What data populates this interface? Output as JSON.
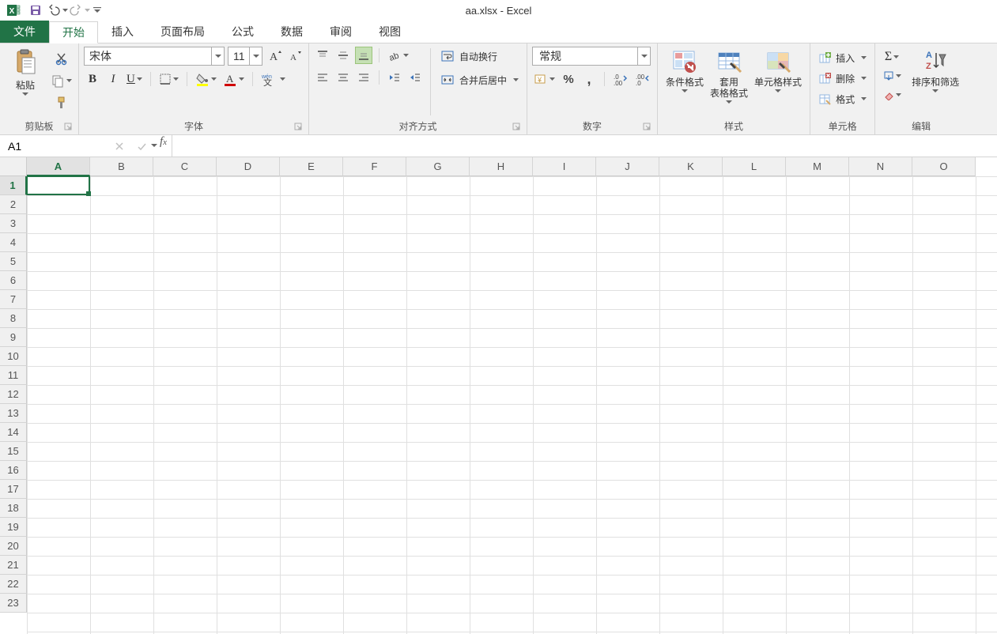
{
  "title": "aa.xlsx - Excel",
  "qat": {
    "undo_enabled": true,
    "redo_enabled": false
  },
  "tabs": {
    "file": "文件",
    "items": [
      "开始",
      "插入",
      "页面布局",
      "公式",
      "数据",
      "审阅",
      "视图"
    ],
    "active_index": 0
  },
  "ribbon": {
    "clipboard": {
      "paste": "粘贴",
      "label": "剪贴板"
    },
    "font": {
      "name": "宋体",
      "size": "11",
      "label": "字体"
    },
    "alignment": {
      "wrap": "自动换行",
      "merge": "合并后居中",
      "label": "对齐方式"
    },
    "number": {
      "format": "常规",
      "label": "数字"
    },
    "styles": {
      "cond": "条件格式",
      "table": "套用",
      "table2": "表格格式",
      "cell": "单元格样式",
      "label": "样式"
    },
    "cells": {
      "insert": "插入",
      "delete": "删除",
      "format": "格式",
      "label": "单元格"
    },
    "editing": {
      "sortfilter": "排序和筛选",
      "label": "编辑"
    }
  },
  "formula_bar": {
    "name_box": "A1",
    "formula": ""
  },
  "grid": {
    "columns": [
      "A",
      "B",
      "C",
      "D",
      "E",
      "F",
      "G",
      "H",
      "I",
      "J",
      "K",
      "L",
      "M",
      "N",
      "O"
    ],
    "rows": [
      "1",
      "2",
      "3",
      "4",
      "5",
      "6",
      "7",
      "8",
      "9",
      "10",
      "11",
      "12",
      "13",
      "14",
      "15",
      "16",
      "17",
      "18",
      "19",
      "20",
      "21",
      "22",
      "23"
    ],
    "active_col_index": 0,
    "active_row_index": 0
  }
}
